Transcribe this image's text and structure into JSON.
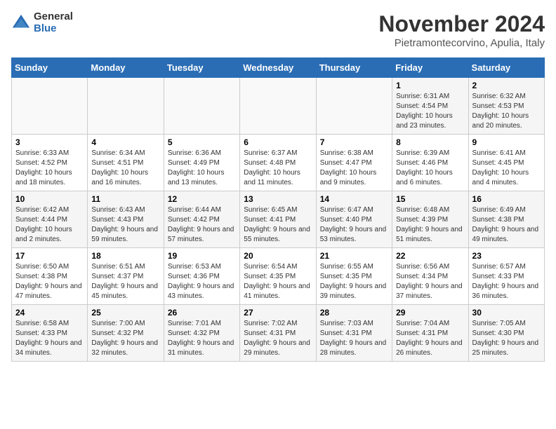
{
  "logo": {
    "general": "General",
    "blue": "Blue"
  },
  "title": "November 2024",
  "subtitle": "Pietramontecorvino, Apulia, Italy",
  "days_of_week": [
    "Sunday",
    "Monday",
    "Tuesday",
    "Wednesday",
    "Thursday",
    "Friday",
    "Saturday"
  ],
  "weeks": [
    [
      {
        "day": "",
        "info": ""
      },
      {
        "day": "",
        "info": ""
      },
      {
        "day": "",
        "info": ""
      },
      {
        "day": "",
        "info": ""
      },
      {
        "day": "",
        "info": ""
      },
      {
        "day": "1",
        "info": "Sunrise: 6:31 AM\nSunset: 4:54 PM\nDaylight: 10 hours and 23 minutes."
      },
      {
        "day": "2",
        "info": "Sunrise: 6:32 AM\nSunset: 4:53 PM\nDaylight: 10 hours and 20 minutes."
      }
    ],
    [
      {
        "day": "3",
        "info": "Sunrise: 6:33 AM\nSunset: 4:52 PM\nDaylight: 10 hours and 18 minutes."
      },
      {
        "day": "4",
        "info": "Sunrise: 6:34 AM\nSunset: 4:51 PM\nDaylight: 10 hours and 16 minutes."
      },
      {
        "day": "5",
        "info": "Sunrise: 6:36 AM\nSunset: 4:49 PM\nDaylight: 10 hours and 13 minutes."
      },
      {
        "day": "6",
        "info": "Sunrise: 6:37 AM\nSunset: 4:48 PM\nDaylight: 10 hours and 11 minutes."
      },
      {
        "day": "7",
        "info": "Sunrise: 6:38 AM\nSunset: 4:47 PM\nDaylight: 10 hours and 9 minutes."
      },
      {
        "day": "8",
        "info": "Sunrise: 6:39 AM\nSunset: 4:46 PM\nDaylight: 10 hours and 6 minutes."
      },
      {
        "day": "9",
        "info": "Sunrise: 6:41 AM\nSunset: 4:45 PM\nDaylight: 10 hours and 4 minutes."
      }
    ],
    [
      {
        "day": "10",
        "info": "Sunrise: 6:42 AM\nSunset: 4:44 PM\nDaylight: 10 hours and 2 minutes."
      },
      {
        "day": "11",
        "info": "Sunrise: 6:43 AM\nSunset: 4:43 PM\nDaylight: 9 hours and 59 minutes."
      },
      {
        "day": "12",
        "info": "Sunrise: 6:44 AM\nSunset: 4:42 PM\nDaylight: 9 hours and 57 minutes."
      },
      {
        "day": "13",
        "info": "Sunrise: 6:45 AM\nSunset: 4:41 PM\nDaylight: 9 hours and 55 minutes."
      },
      {
        "day": "14",
        "info": "Sunrise: 6:47 AM\nSunset: 4:40 PM\nDaylight: 9 hours and 53 minutes."
      },
      {
        "day": "15",
        "info": "Sunrise: 6:48 AM\nSunset: 4:39 PM\nDaylight: 9 hours and 51 minutes."
      },
      {
        "day": "16",
        "info": "Sunrise: 6:49 AM\nSunset: 4:38 PM\nDaylight: 9 hours and 49 minutes."
      }
    ],
    [
      {
        "day": "17",
        "info": "Sunrise: 6:50 AM\nSunset: 4:38 PM\nDaylight: 9 hours and 47 minutes."
      },
      {
        "day": "18",
        "info": "Sunrise: 6:51 AM\nSunset: 4:37 PM\nDaylight: 9 hours and 45 minutes."
      },
      {
        "day": "19",
        "info": "Sunrise: 6:53 AM\nSunset: 4:36 PM\nDaylight: 9 hours and 43 minutes."
      },
      {
        "day": "20",
        "info": "Sunrise: 6:54 AM\nSunset: 4:35 PM\nDaylight: 9 hours and 41 minutes."
      },
      {
        "day": "21",
        "info": "Sunrise: 6:55 AM\nSunset: 4:35 PM\nDaylight: 9 hours and 39 minutes."
      },
      {
        "day": "22",
        "info": "Sunrise: 6:56 AM\nSunset: 4:34 PM\nDaylight: 9 hours and 37 minutes."
      },
      {
        "day": "23",
        "info": "Sunrise: 6:57 AM\nSunset: 4:33 PM\nDaylight: 9 hours and 36 minutes."
      }
    ],
    [
      {
        "day": "24",
        "info": "Sunrise: 6:58 AM\nSunset: 4:33 PM\nDaylight: 9 hours and 34 minutes."
      },
      {
        "day": "25",
        "info": "Sunrise: 7:00 AM\nSunset: 4:32 PM\nDaylight: 9 hours and 32 minutes."
      },
      {
        "day": "26",
        "info": "Sunrise: 7:01 AM\nSunset: 4:32 PM\nDaylight: 9 hours and 31 minutes."
      },
      {
        "day": "27",
        "info": "Sunrise: 7:02 AM\nSunset: 4:31 PM\nDaylight: 9 hours and 29 minutes."
      },
      {
        "day": "28",
        "info": "Sunrise: 7:03 AM\nSunset: 4:31 PM\nDaylight: 9 hours and 28 minutes."
      },
      {
        "day": "29",
        "info": "Sunrise: 7:04 AM\nSunset: 4:31 PM\nDaylight: 9 hours and 26 minutes."
      },
      {
        "day": "30",
        "info": "Sunrise: 7:05 AM\nSunset: 4:30 PM\nDaylight: 9 hours and 25 minutes."
      }
    ]
  ]
}
